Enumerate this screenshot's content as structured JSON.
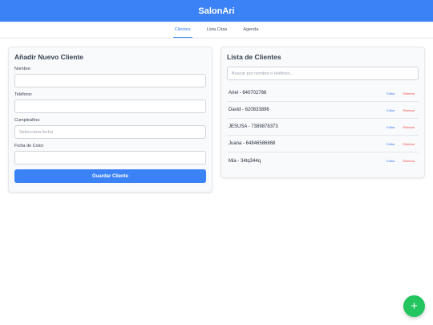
{
  "app": {
    "title": "SalonAri"
  },
  "nav": {
    "tabs": [
      {
        "label": "Clientes"
      },
      {
        "label": "Lista Citas"
      },
      {
        "label": "Agenda"
      }
    ]
  },
  "form": {
    "title": "Añadir Nuevo Cliente",
    "name_label": "Nombre:",
    "name_value": "",
    "phone_label": "Teléfono:",
    "phone_value": "",
    "birthday_label": "Cumpleaños:",
    "birthday_placeholder": "Selecciona fecha",
    "color_label": "Ficha de Color:",
    "color_value": "",
    "save_label": "Guardar Cliente"
  },
  "clients": {
    "title": "Lista de Clientes",
    "search_placeholder": "Buscar por nombre o teléfono...",
    "edit_label": "Editar",
    "delete_label": "Eliminar",
    "items": [
      {
        "label": "Ariel - 640702766"
      },
      {
        "label": "David - 620833896"
      },
      {
        "label": "JESUSA - 7389878373"
      },
      {
        "label": "Juana - 64846586868"
      },
      {
        "label": "Mia - 34tq344q"
      }
    ]
  },
  "fab": {
    "icon": "plus-icon",
    "symbol": "+"
  },
  "colors": {
    "primary": "#3b82f6",
    "danger": "#ef4444",
    "success": "#22c55e"
  }
}
